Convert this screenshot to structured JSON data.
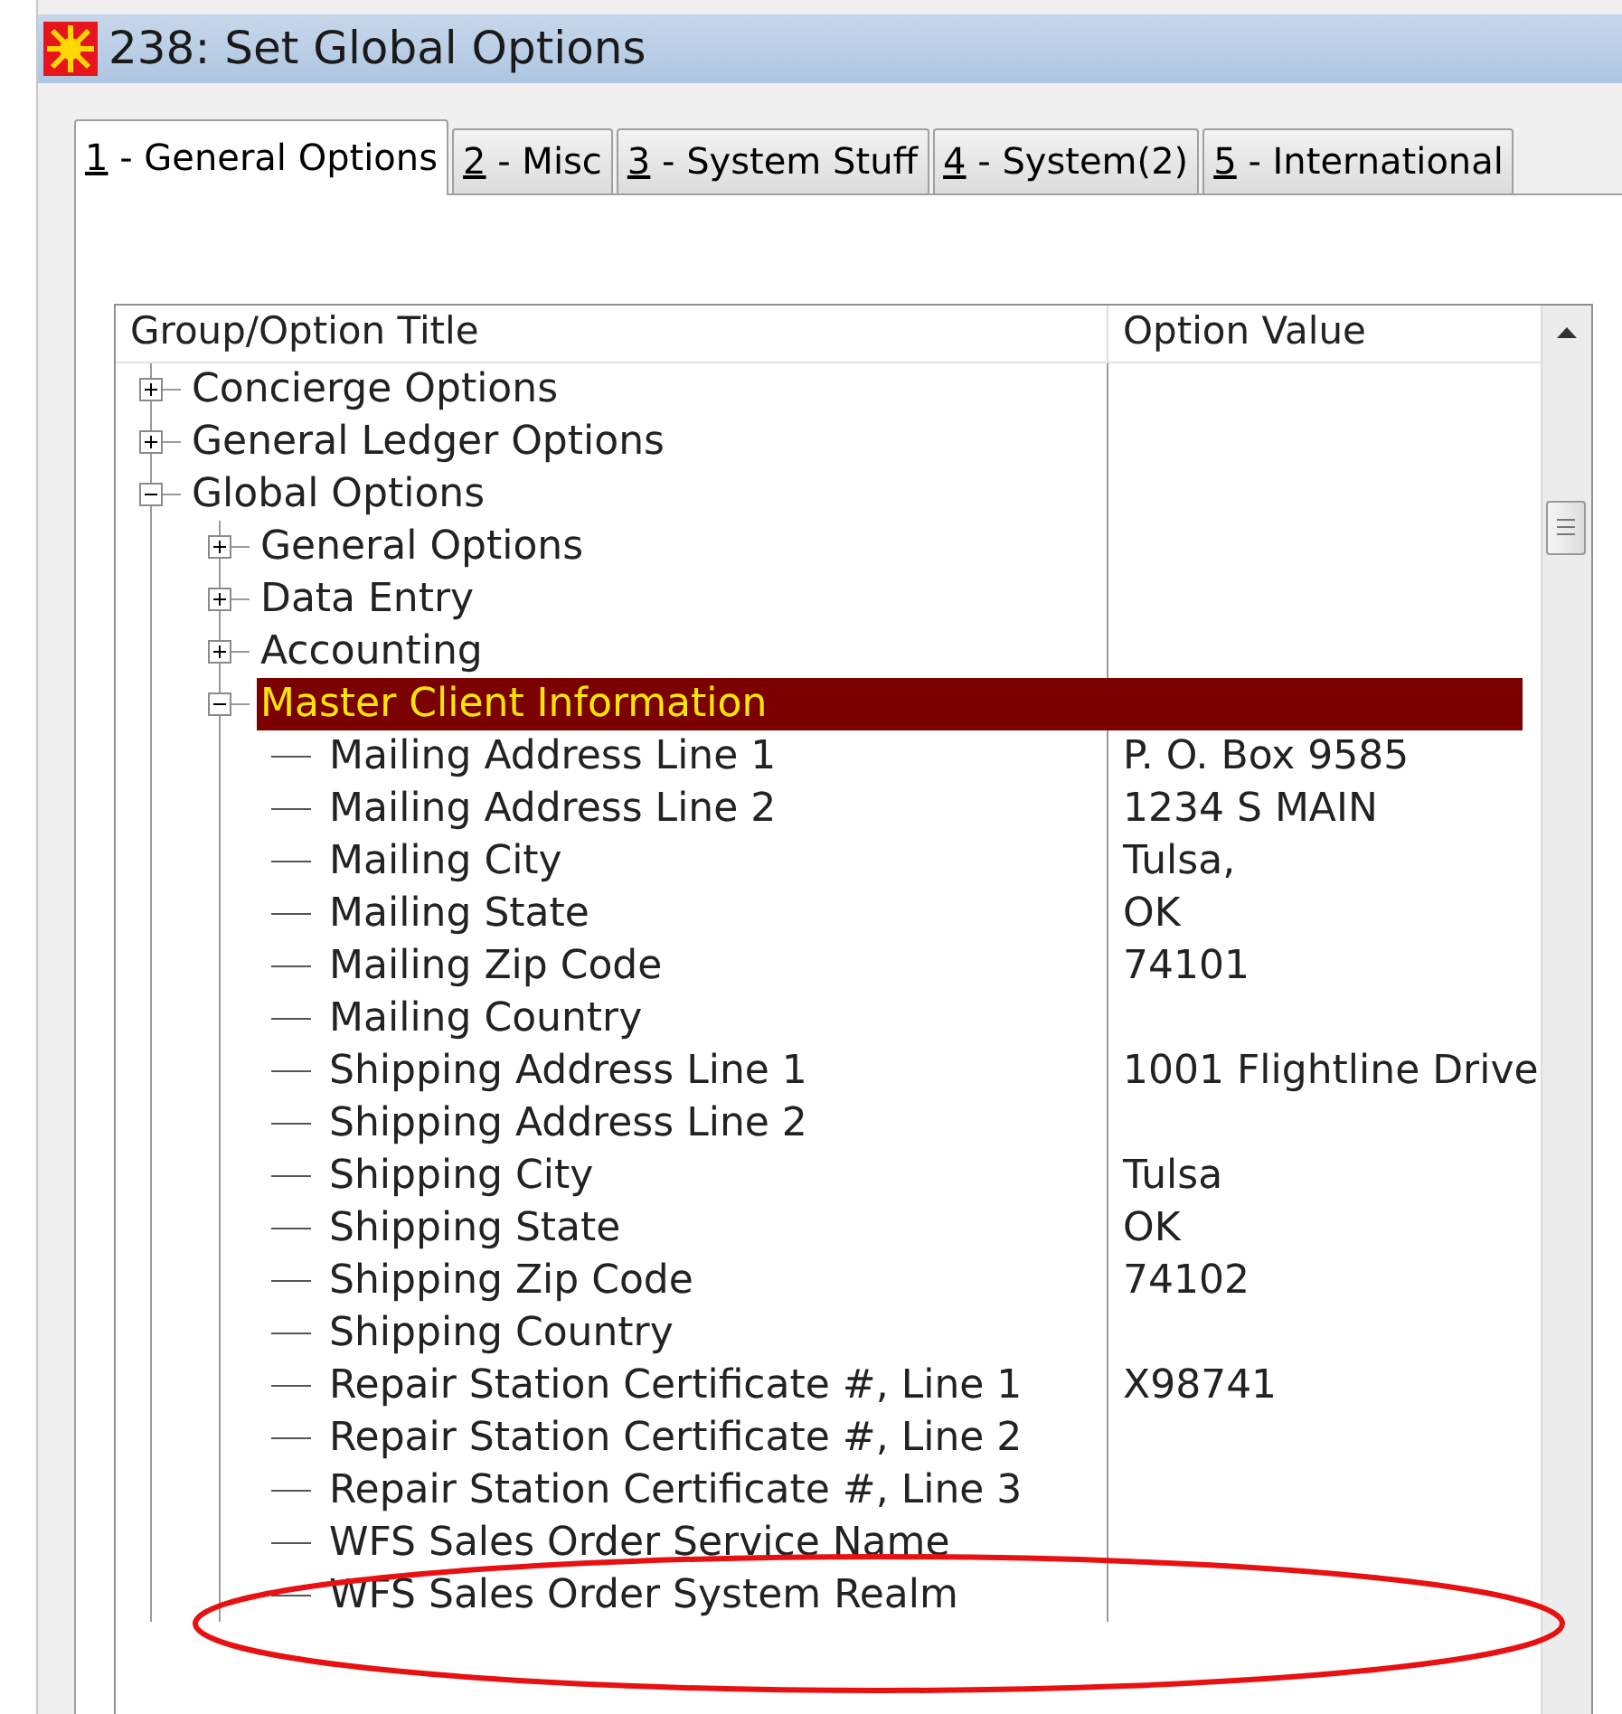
{
  "window": {
    "title": "238: Set Global Options"
  },
  "tabs": [
    {
      "label": "1 - General Options",
      "selected": true
    },
    {
      "label": "2 - Misc",
      "selected": false
    },
    {
      "label": "3 - System Stuff",
      "selected": false
    },
    {
      "label": "4 - System(2)",
      "selected": false
    },
    {
      "label": "5 - International",
      "selected": false
    }
  ],
  "tree": {
    "columns": [
      "Group/Option Title",
      "Option Value"
    ],
    "rows": [
      {
        "label": "Concierge Options",
        "expanded": false,
        "selected": false
      },
      {
        "label": "General Ledger Options",
        "expanded": false,
        "selected": false
      },
      {
        "label": "Global Options",
        "expanded": true,
        "selected": false,
        "children": [
          {
            "label": "General Options",
            "expanded": false,
            "selected": false
          },
          {
            "label": "Data Entry",
            "expanded": false,
            "selected": false
          },
          {
            "label": "Accounting",
            "expanded": false,
            "selected": false
          },
          {
            "label": "Master Client Information",
            "expanded": true,
            "selected": true,
            "children": [
              {
                "label": "Mailing Address Line 1",
                "value": "P. O. Box 9585",
                "selected": false
              },
              {
                "label": "Mailing Address Line 2",
                "value": "1234 S MAIN",
                "selected": false
              },
              {
                "label": "Mailing City",
                "value": "Tulsa,",
                "selected": false
              },
              {
                "label": "Mailing State",
                "value": "OK",
                "selected": false
              },
              {
                "label": "Mailing Zip Code",
                "value": "74101",
                "selected": false
              },
              {
                "label": "Mailing Country",
                "selected": false
              },
              {
                "label": "Shipping Address Line 1",
                "value": "1001 Flightline Drive",
                "selected": false
              },
              {
                "label": "Shipping Address Line 2",
                "selected": false
              },
              {
                "label": "Shipping City",
                "value": "Tulsa",
                "selected": false
              },
              {
                "label": "Shipping State",
                "value": "OK",
                "selected": false
              },
              {
                "label": "Shipping Zip Code",
                "value": "74102",
                "selected": false
              },
              {
                "label": "Shipping Country",
                "selected": false
              },
              {
                "label": "Repair Station Certificate #, Line 1",
                "value": "X98741",
                "selected": false
              },
              {
                "label": "Repair Station Certificate #, Line 2",
                "selected": false
              },
              {
                "label": "Repair Station Certificate #, Line 3",
                "selected": false
              },
              {
                "label": "WFS Sales Order Service Name",
                "selected": false
              },
              {
                "label": "WFS Sales Order System Realm",
                "selected": false
              }
            ]
          }
        ]
      }
    ]
  }
}
